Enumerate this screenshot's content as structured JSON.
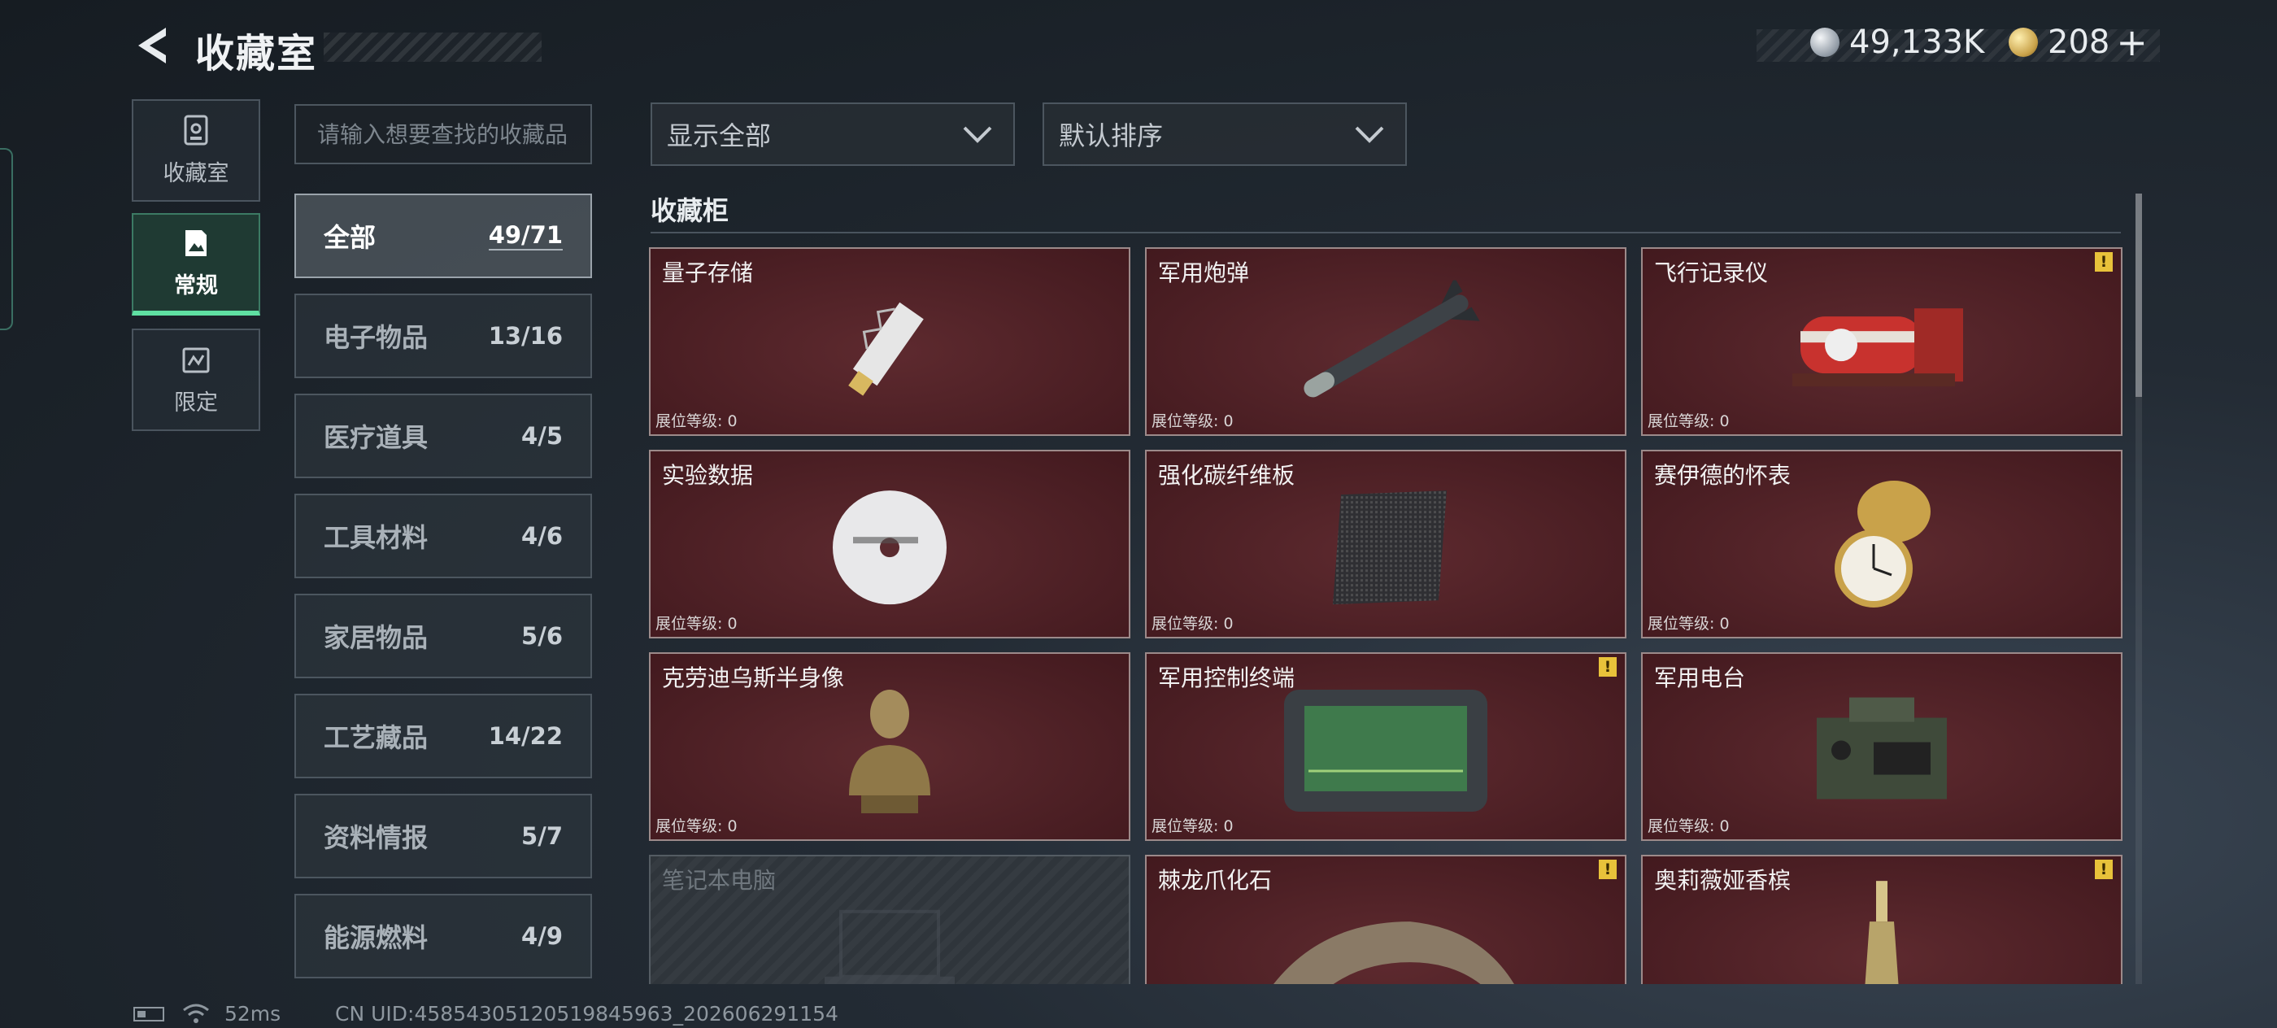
{
  "header": {
    "title": "收藏室",
    "currency_silver": "49,133K",
    "currency_gold": "208",
    "plus": "+"
  },
  "rail": [
    {
      "label": "收藏室",
      "icon": "display-case-icon",
      "active": false
    },
    {
      "label": "常规",
      "icon": "picture-icon",
      "active": true
    },
    {
      "label": "限定",
      "icon": "limited-icon",
      "active": false
    }
  ],
  "search": {
    "placeholder": "请输入想要查找的收藏品"
  },
  "categories": [
    {
      "name": "全部",
      "count": "49/71",
      "active": true
    },
    {
      "name": "电子物品",
      "count": "13/16"
    },
    {
      "name": "医疗道具",
      "count": "4/5"
    },
    {
      "name": "工具材料",
      "count": "4/6"
    },
    {
      "name": "家居物品",
      "count": "5/6"
    },
    {
      "name": "工艺藏品",
      "count": "14/22"
    },
    {
      "name": "资料情报",
      "count": "5/7"
    },
    {
      "name": "能源燃料",
      "count": "4/9"
    }
  ],
  "filters": {
    "show": "显示全部",
    "sort": "默认排序"
  },
  "section_title": "收藏柜",
  "level_label": "展位等级: 0",
  "items": [
    {
      "name": "量子存储",
      "warn": false,
      "locked": false,
      "art": "usb-drive-icon"
    },
    {
      "name": "军用炮弹",
      "warn": false,
      "locked": false,
      "art": "missile-icon"
    },
    {
      "name": "飞行记录仪",
      "warn": true,
      "locked": false,
      "art": "flight-recorder-icon"
    },
    {
      "name": "实验数据",
      "warn": false,
      "locked": false,
      "art": "disc-icon"
    },
    {
      "name": "强化碳纤维板",
      "warn": false,
      "locked": false,
      "art": "carbon-plate-icon"
    },
    {
      "name": "赛伊德的怀表",
      "warn": false,
      "locked": false,
      "art": "pocket-watch-icon"
    },
    {
      "name": "克劳迪乌斯半身像",
      "warn": false,
      "locked": false,
      "art": "bust-icon"
    },
    {
      "name": "军用控制终端",
      "warn": true,
      "locked": false,
      "art": "control-terminal-icon"
    },
    {
      "name": "军用电台",
      "warn": false,
      "locked": false,
      "art": "radio-icon"
    },
    {
      "name": "笔记本电脑",
      "warn": false,
      "locked": true,
      "art": "laptop-icon"
    },
    {
      "name": "棘龙爪化石",
      "warn": true,
      "locked": false,
      "art": "claw-fossil-icon"
    },
    {
      "name": "奥莉薇娅香槟",
      "warn": true,
      "locked": false,
      "art": "champagne-icon"
    }
  ],
  "status": {
    "ping": "52ms",
    "uid": "CN UID:4585430512051984596​3_202606291154"
  }
}
